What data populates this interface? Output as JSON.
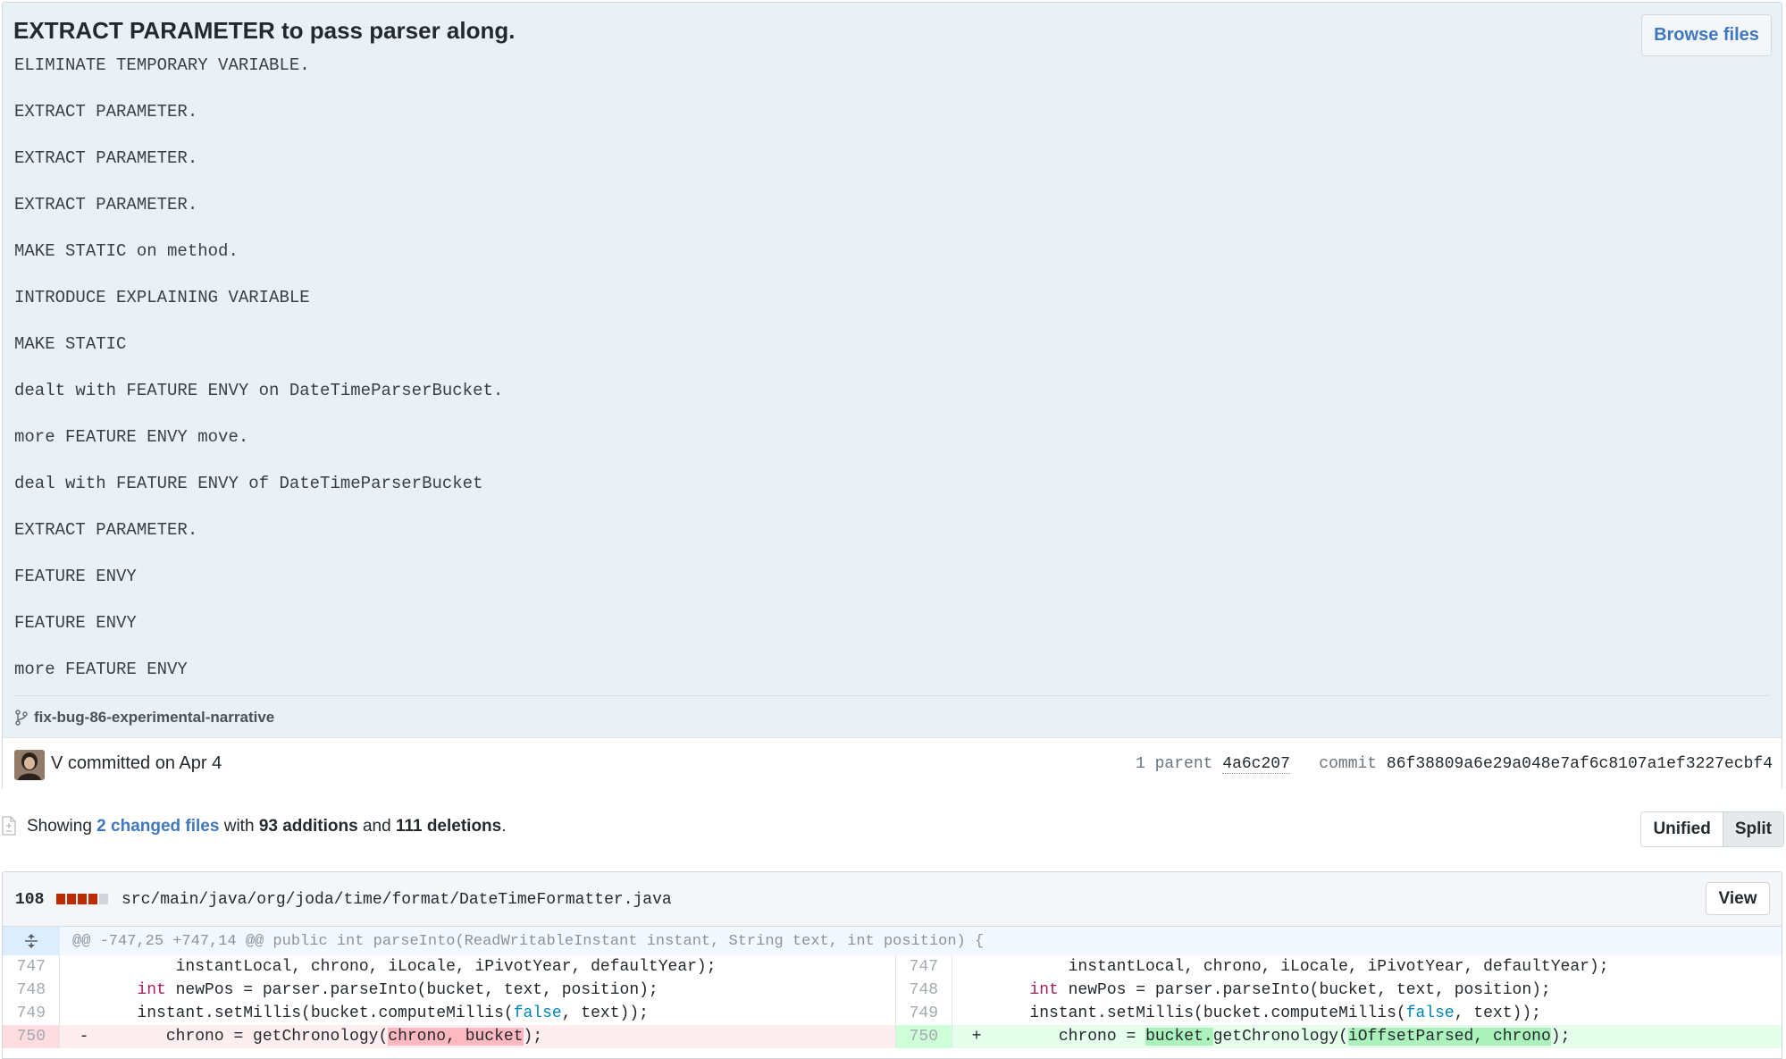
{
  "commit": {
    "title": "EXTRACT PARAMETER to pass parser along.",
    "browse_files_label": "Browse files",
    "message_lines": [
      "ELIMINATE TEMPORARY VARIABLE.",
      "EXTRACT PARAMETER.",
      "EXTRACT PARAMETER.",
      "EXTRACT PARAMETER.",
      "MAKE STATIC on method.",
      "INTRODUCE EXPLAINING VARIABLE",
      "MAKE STATIC",
      "dealt with FEATURE ENVY on DateTimeParserBucket.",
      "more FEATURE ENVY move.",
      "deal with FEATURE ENVY of DateTimeParserBucket",
      "EXTRACT PARAMETER.",
      "FEATURE ENVY",
      "FEATURE ENVY",
      "more FEATURE ENVY"
    ],
    "branch": "fix-bug-86-experimental-narrative",
    "author_line": "V committed on Apr 4",
    "parent_label": "1 parent",
    "parent_sha": "4a6c207",
    "commit_label": "commit",
    "commit_sha": "86f38809a6e29a048e7af6c8107a1ef3227ecbf4"
  },
  "summary": {
    "showing": "Showing",
    "changed_files": "2 changed files",
    "with": "with",
    "additions": "93 additions",
    "and": "and",
    "deletions": "111 deletions",
    "period": ".",
    "unified_label": "Unified",
    "split_label": "Split",
    "active_view": "Split"
  },
  "file": {
    "change_count": "108",
    "path": "src/main/java/org/joda/time/format/DateTimeFormatter.java",
    "view_label": "View",
    "hunk_header": "@@ -747,25 +747,14 @@ public int parseInto(ReadWritableInstant instant, String text, int position) {"
  },
  "diff": {
    "rows": [
      {
        "left_num": "747",
        "right_num": "747",
        "text": "            instantLocal, chrono, iLocale, iPivotYear, defaultYear);"
      },
      {
        "left_num": "748",
        "right_num": "748",
        "pre": "        ",
        "kw": "int",
        "post": " newPos = parser.parseInto(bucket, text, position);"
      },
      {
        "left_num": "749",
        "right_num": "749",
        "pre": "        instant.setMillis(bucket.computeMillis(",
        "bool": "false",
        "post": ", text));"
      }
    ],
    "changed": {
      "left_num": "750",
      "left_marker": "-",
      "left_pre": "        chrono = getChronology(",
      "left_hl": "chrono, bucket",
      "left_post": ");",
      "right_num": "750",
      "right_marker": "+",
      "right_pre": "        chrono = ",
      "right_hl1": "bucket.",
      "right_mid": "getChronology(",
      "right_hl2": "iOffsetParsed, chrono",
      "right_post": ");"
    }
  },
  "colors": {
    "accent": "#4078c0",
    "commit_bg": "#eaf1f6",
    "deletion": "#bd2c00",
    "addition_bg": "#e6ffed",
    "deletion_bg": "#ffeef0"
  }
}
